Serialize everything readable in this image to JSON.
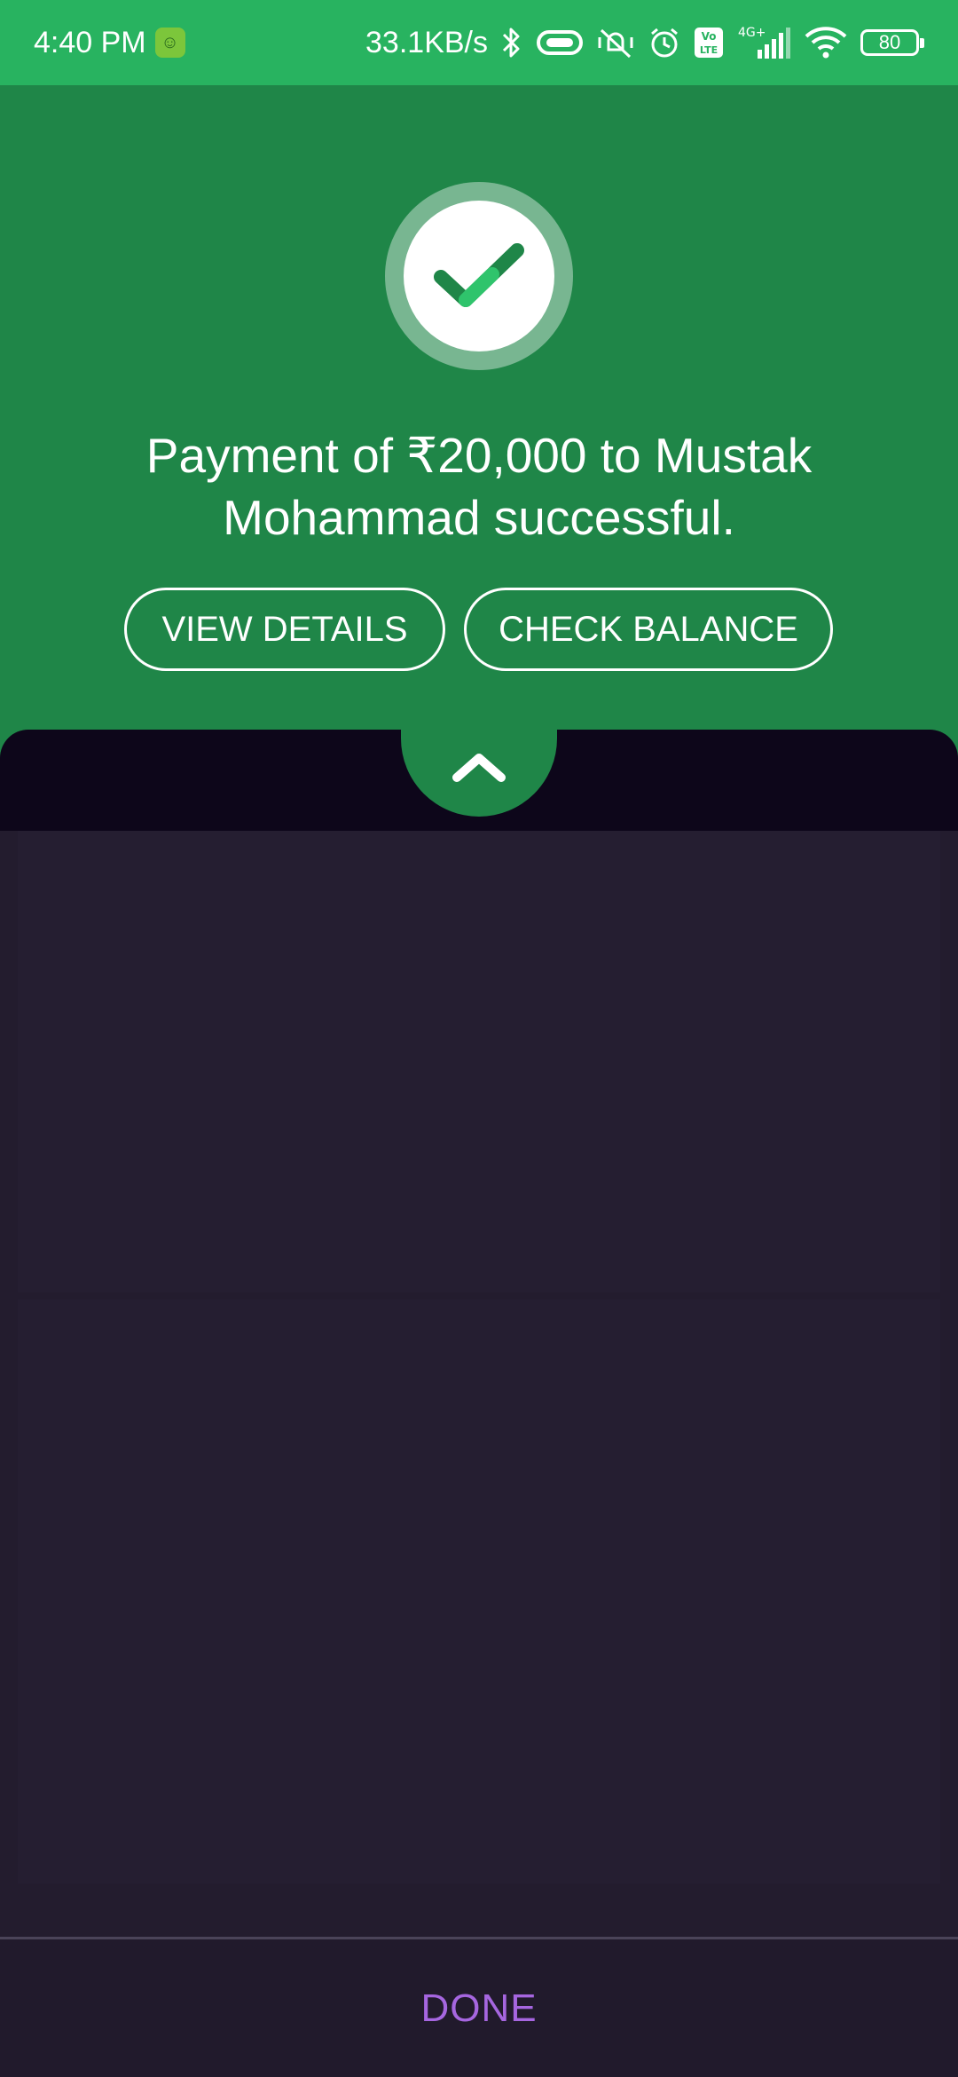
{
  "status_bar": {
    "time": "4:40 PM",
    "network_speed": "33.1KB/s",
    "network_type": "4G+",
    "volte_label": "Vo LTE",
    "battery_level": "80",
    "icons": [
      "app-notification-icon",
      "bluetooth-icon",
      "link-icon",
      "vibrate-silent-icon",
      "alarm-icon",
      "volte-icon",
      "signal-icon",
      "wifi-icon",
      "battery-icon"
    ]
  },
  "success": {
    "message": "Payment of ₹20,000 to Mustak Mohammad successful.",
    "view_details_label": "VIEW DETAILS",
    "check_balance_label": "CHECK BALANCE"
  },
  "footer": {
    "done_label": "DONE"
  },
  "colors": {
    "status_bar": "#28b360",
    "success_green": "#1f8648",
    "sheet_dark": "#0d061a",
    "body_bg": "#231c2e",
    "accent_purple": "#a666e0"
  }
}
